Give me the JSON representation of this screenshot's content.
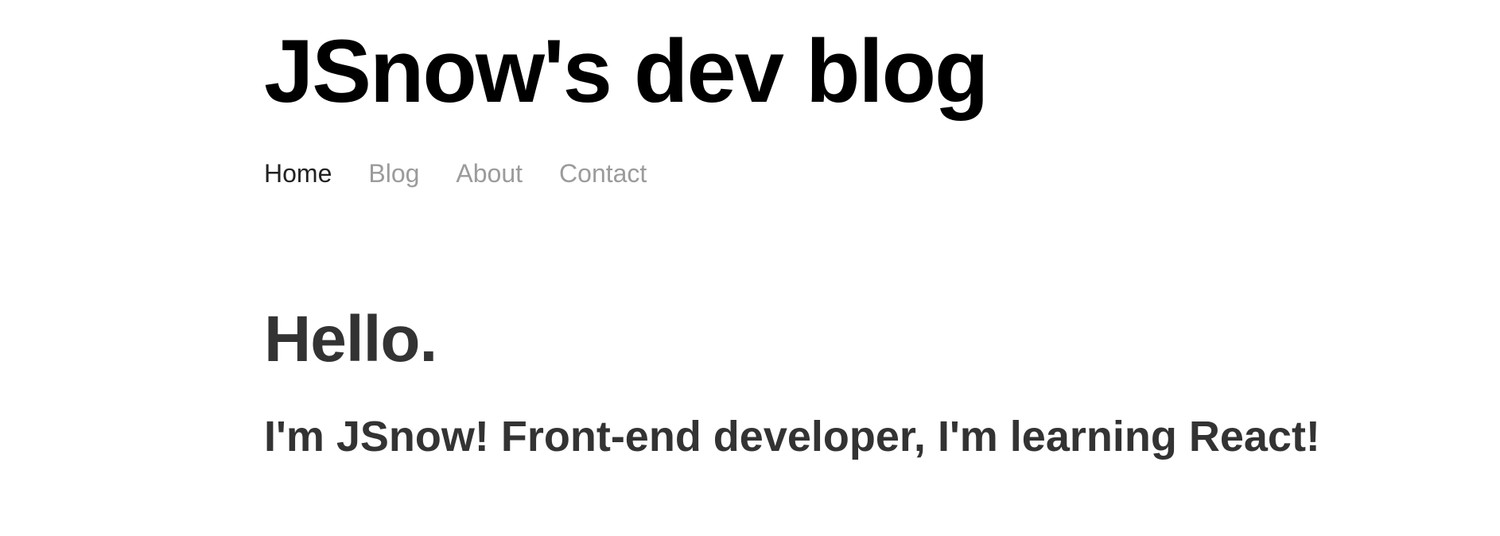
{
  "header": {
    "site_title": "JSnow's dev blog"
  },
  "nav": {
    "items": [
      {
        "label": "Home",
        "active": true
      },
      {
        "label": "Blog",
        "active": false
      },
      {
        "label": "About",
        "active": false
      },
      {
        "label": "Contact",
        "active": false
      }
    ]
  },
  "main": {
    "heading": "Hello.",
    "subheading": "I'm JSnow! Front-end developer, I'm learning React!"
  },
  "colors": {
    "title": "#000000",
    "text": "#333333",
    "nav_active": "#222222",
    "nav_inactive": "#9b9b9b",
    "background": "#ffffff"
  }
}
